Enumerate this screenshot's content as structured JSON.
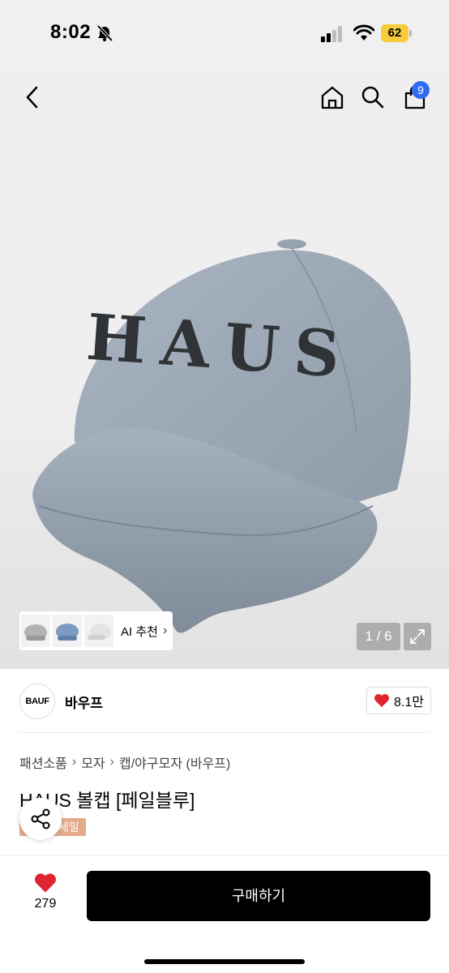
{
  "status_bar": {
    "time": "8:02",
    "battery": "62"
  },
  "nav": {
    "cart_count": "9"
  },
  "gallery": {
    "ai_recommend_label": "AI 추천",
    "page_counter": "1 / 6",
    "product_image_text": "HAUS",
    "colors": {
      "cap": "#9fabb9",
      "embroidery": "#2f3336"
    }
  },
  "brand": {
    "logo_text": "BAUF",
    "name": "바우프",
    "likes": "8.1만"
  },
  "breadcrumb": [
    "패션소품",
    "모자",
    "캡/야구모자 (바우프)"
  ],
  "product": {
    "title": "HAUS 볼캡 [페일블루]",
    "sale_badge": "세일"
  },
  "bottom": {
    "wish_count": "279",
    "buy_label": "구매하기"
  },
  "accent": {
    "heart": "#e0242f",
    "badge": "#2f6cf6",
    "battery": "#f7cc3b"
  }
}
